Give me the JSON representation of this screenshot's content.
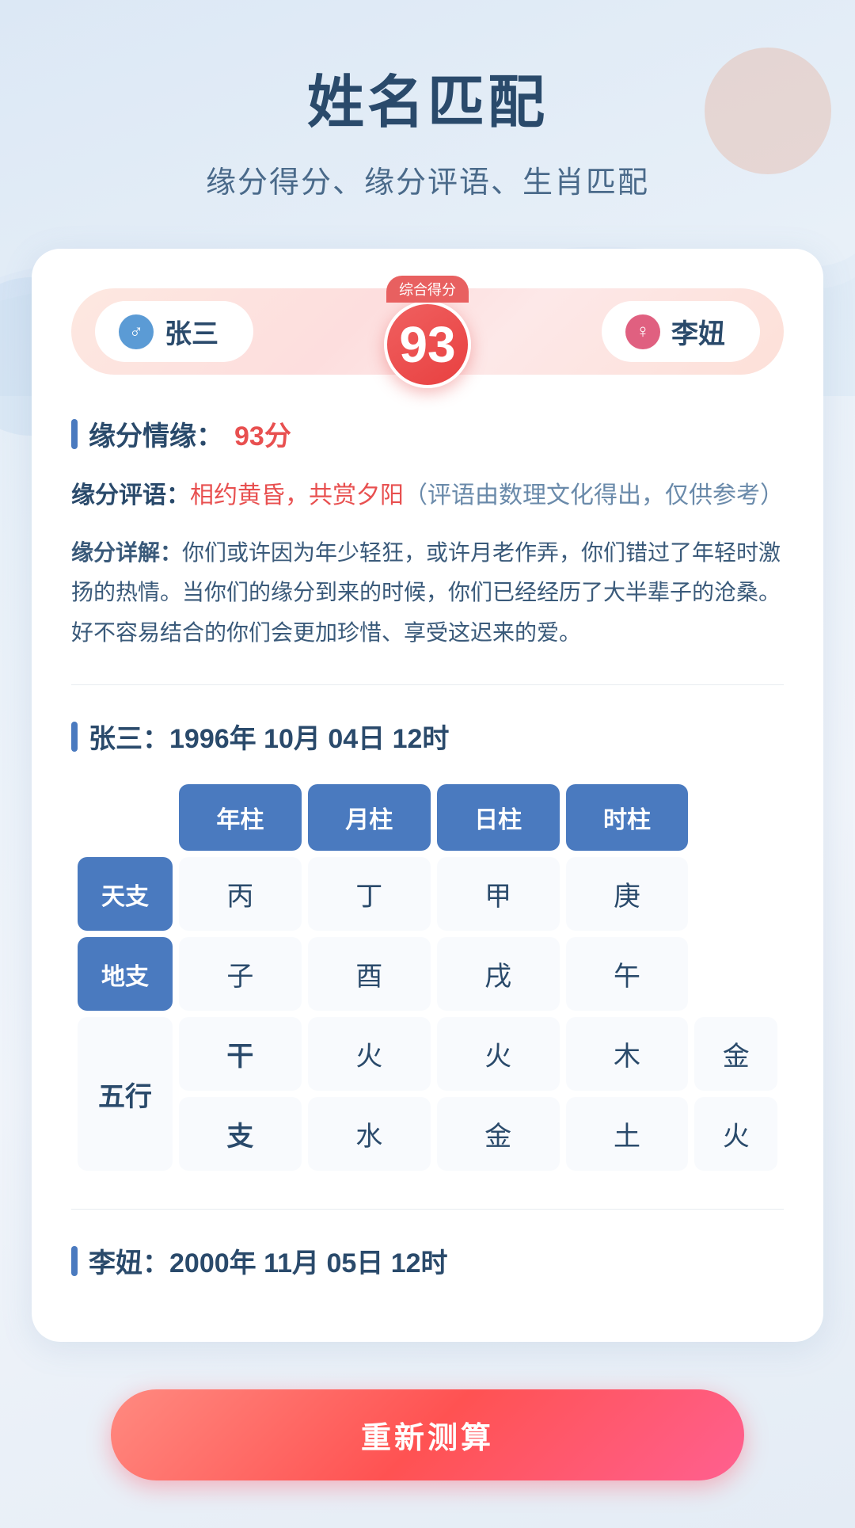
{
  "page": {
    "title": "姓名匹配",
    "subtitle": "缘分得分、缘分评语、生肖匹配"
  },
  "score_bar": {
    "person1": {
      "name": "张三",
      "gender": "male",
      "icon": "♂"
    },
    "score": {
      "label": "综合得分",
      "value": "93"
    },
    "person2": {
      "name": "李妞",
      "gender": "female",
      "icon": "♀"
    }
  },
  "yuan_section": {
    "heading": "缘分情缘：",
    "score_text": "93分",
    "comment_label": "缘分评语：",
    "comment_highlight": "相约黄昏，共赏夕阳",
    "comment_note": "（评语由数理文化得出，仅供参考）",
    "detail_label": "缘分详解：",
    "detail_text": "你们或许因为年少轻狂，或许月老作弄，你们错过了年轻时激扬的热情。当你们的缘分到来的时候，你们已经经历了大半辈子的沧桑。好不容易结合的你们会更加珍惜、享受这迟来的爱。"
  },
  "person1_section": {
    "name": "张三",
    "date": "1996年 10月 04日 12时",
    "table": {
      "headers": [
        "年柱",
        "月柱",
        "日柱",
        "时柱"
      ],
      "rows": [
        {
          "row_header": "天支",
          "cells": [
            "丙",
            "丁",
            "甲",
            "庚"
          ]
        },
        {
          "row_header": "地支",
          "cells": [
            "子",
            "酉",
            "戌",
            "午"
          ]
        }
      ],
      "wuxing": {
        "main_label": "五行",
        "sub_rows": [
          {
            "sub_label": "干",
            "cells": [
              "火",
              "火",
              "木",
              "金"
            ]
          },
          {
            "sub_label": "支",
            "cells": [
              "水",
              "金",
              "土",
              "火"
            ]
          }
        ]
      }
    }
  },
  "person2_section": {
    "name": "李妞",
    "date": "2000年 11月 05日 12时"
  },
  "button": {
    "label": "重新测算"
  }
}
